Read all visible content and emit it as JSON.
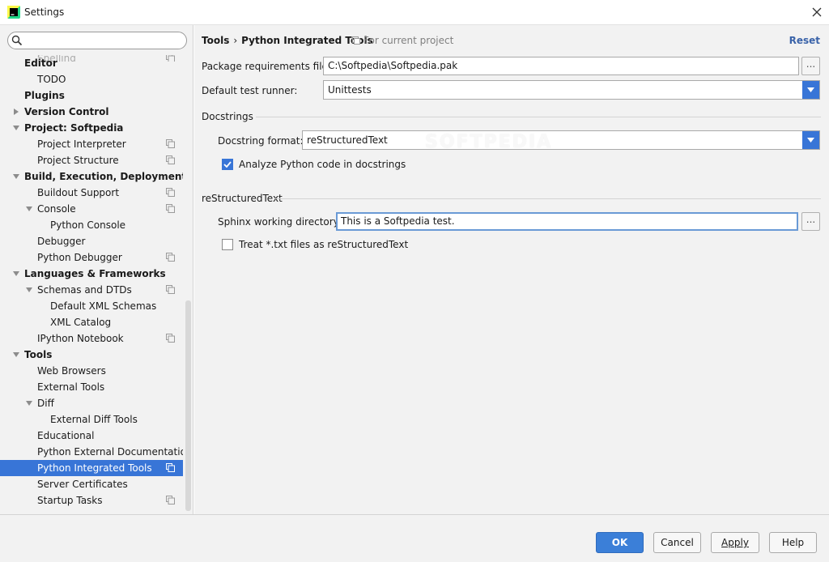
{
  "window": {
    "title": "Settings"
  },
  "search": {
    "placeholder": "",
    "value": ""
  },
  "tree": [
    {
      "label": "Spelling",
      "level": 1,
      "bold": false,
      "project": true,
      "partial": true
    },
    {
      "label": "Editor",
      "level": 0,
      "bold": true,
      "project": false
    },
    {
      "label": "TODO",
      "level": 1,
      "bold": false,
      "project": false
    },
    {
      "label": "Plugins",
      "level": 0,
      "bold": true,
      "project": false
    },
    {
      "label": "Version Control",
      "level": 0,
      "bold": true,
      "arrow": "right",
      "project": false
    },
    {
      "label": "Project: Softpedia",
      "level": 0,
      "bold": true,
      "arrow": "down",
      "project": false
    },
    {
      "label": "Project Interpreter",
      "level": 1,
      "bold": false,
      "project": true
    },
    {
      "label": "Project Structure",
      "level": 1,
      "bold": false,
      "project": true
    },
    {
      "label": "Build, Execution, Deployment",
      "level": 0,
      "bold": true,
      "arrow": "down",
      "project": false
    },
    {
      "label": "Buildout Support",
      "level": 1,
      "bold": false,
      "project": true
    },
    {
      "label": "Console",
      "level": 1,
      "bold": false,
      "arrow": "down",
      "project": true
    },
    {
      "label": "Python Console",
      "level": 2,
      "bold": false,
      "project": false
    },
    {
      "label": "Debugger",
      "level": 1,
      "bold": false,
      "project": false
    },
    {
      "label": "Python Debugger",
      "level": 1,
      "bold": false,
      "project": true
    },
    {
      "label": "Languages & Frameworks",
      "level": 0,
      "bold": true,
      "arrow": "down",
      "project": false
    },
    {
      "label": "Schemas and DTDs",
      "level": 1,
      "bold": false,
      "arrow": "down",
      "project": true
    },
    {
      "label": "Default XML Schemas",
      "level": 2,
      "bold": false,
      "project": false
    },
    {
      "label": "XML Catalog",
      "level": 2,
      "bold": false,
      "project": false
    },
    {
      "label": "IPython Notebook",
      "level": 1,
      "bold": false,
      "project": true
    },
    {
      "label": "Tools",
      "level": 0,
      "bold": true,
      "arrow": "down",
      "project": false
    },
    {
      "label": "Web Browsers",
      "level": 1,
      "bold": false,
      "project": false
    },
    {
      "label": "External Tools",
      "level": 1,
      "bold": false,
      "project": false
    },
    {
      "label": "Diff",
      "level": 1,
      "bold": false,
      "arrow": "down",
      "project": false
    },
    {
      "label": "External Diff Tools",
      "level": 2,
      "bold": false,
      "project": false
    },
    {
      "label": "Educational",
      "level": 1,
      "bold": false,
      "project": false
    },
    {
      "label": "Python External Documentation",
      "level": 1,
      "bold": false,
      "project": false
    },
    {
      "label": "Python Integrated Tools",
      "level": 1,
      "bold": false,
      "project": true,
      "selected": true
    },
    {
      "label": "Server Certificates",
      "level": 1,
      "bold": false,
      "project": false
    },
    {
      "label": "Startup Tasks",
      "level": 1,
      "bold": false,
      "project": true
    }
  ],
  "header": {
    "crumb_parent": "Tools",
    "crumb_sep": "›",
    "crumb_current": "Python Integrated Tools",
    "scope": "For current project",
    "reset": "Reset"
  },
  "form": {
    "package_requirements": {
      "label": "Package requirements file:",
      "value": "C:\\Softpedia\\Softpedia.pak"
    },
    "test_runner": {
      "label": "Default test runner:",
      "value": "Unittests"
    },
    "docstrings_title": "Docstrings",
    "docstring_format": {
      "label": "Docstring format:",
      "value": "reStructuredText"
    },
    "analyze_python": {
      "label": "Analyze Python code in docstrings",
      "checked": true
    },
    "rest_title": "reStructuredText",
    "sphinx_dir": {
      "label": "Sphinx working directory:",
      "value": "This is a Softpedia test."
    },
    "treat_txt": {
      "label": "Treat *.txt files as reStructuredText",
      "checked": false
    },
    "browse": "..."
  },
  "watermark": "SOFTPEDIA",
  "footer": {
    "ok": "OK",
    "cancel": "Cancel",
    "apply": "Apply",
    "help": "Help"
  },
  "colors": {
    "accent": "#3875d7",
    "link": "#3a63a9",
    "panel": "#f2f2f2"
  }
}
